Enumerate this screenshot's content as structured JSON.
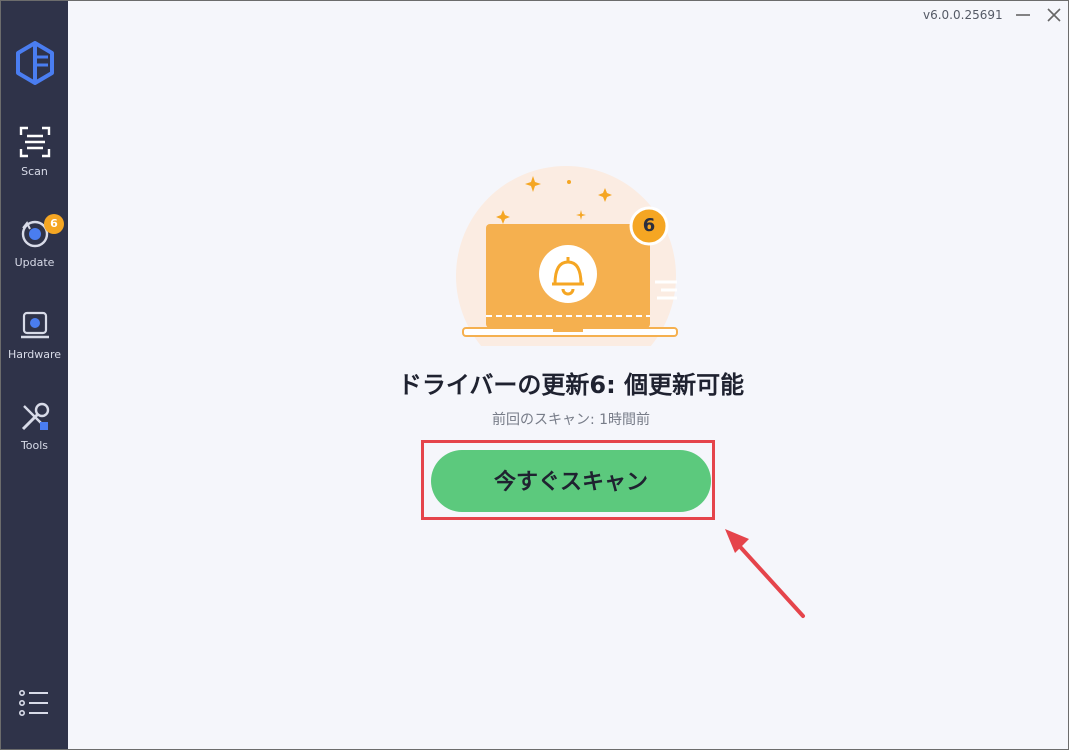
{
  "app": {
    "version": "v6.0.0.25691"
  },
  "sidebar": {
    "items": [
      {
        "label": "Scan",
        "icon": "scan-icon"
      },
      {
        "label": "Update",
        "icon": "update-icon",
        "badge": "6"
      },
      {
        "label": "Hardware",
        "icon": "hardware-icon"
      },
      {
        "label": "Tools",
        "icon": "tools-icon"
      }
    ],
    "menu_icon": "menu-icon"
  },
  "main": {
    "badge_count": "6",
    "title": "ドライバーの更新6: 個更新可能",
    "subtitle": "前回のスキャン: 1時間前",
    "scan_button": "今すぐスキャン"
  },
  "colors": {
    "sidebar_bg": "#2f3349",
    "content_bg": "#f5f6fb",
    "accent_orange": "#f5a623",
    "button_green": "#5cc97d",
    "highlight_red": "#e5444b"
  }
}
